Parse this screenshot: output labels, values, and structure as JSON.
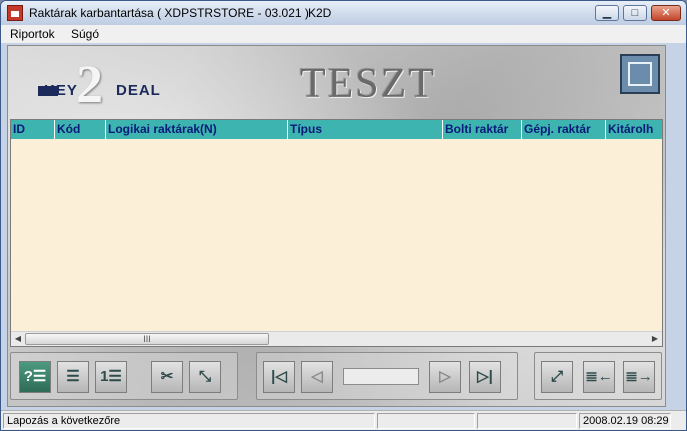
{
  "window": {
    "title": "Raktárak karbantartása ( XDPSTRSTORE - 03.021 )",
    "app_code": "K2D",
    "controls": {
      "minimize": "▁",
      "maximize": "□",
      "close": "✕"
    }
  },
  "menu": [
    {
      "label": "Riportok"
    },
    {
      "label": "Súgó"
    }
  ],
  "banner": {
    "logo": {
      "left": "KEY",
      "digit": "2",
      "right": "DEAL"
    },
    "environment_label": "TESZT"
  },
  "grid": {
    "columns": [
      {
        "label": "ID"
      },
      {
        "label": "Kód"
      },
      {
        "label": "Logikai raktárak(N)"
      },
      {
        "label": "Típus"
      },
      {
        "label": "Bolti raktár"
      },
      {
        "label": "Gépj. raktár"
      },
      {
        "label": "Kitárolh"
      }
    ],
    "rows": [],
    "header_color": "#3db4b0",
    "body_color": "#fcefd8",
    "scroll_thumb_grip": "III"
  },
  "toolbar": {
    "left_group": [
      {
        "icon": "help-list-icon",
        "glyph": "?☰"
      },
      {
        "icon": "list-icon",
        "glyph": "☰"
      },
      {
        "icon": "numbered-list-icon",
        "glyph": "1☰"
      },
      {
        "icon": "tools-icon",
        "glyph": "✂"
      },
      {
        "icon": "unlink-icon",
        "glyph": "⤡"
      }
    ],
    "pager_group": [
      {
        "icon": "first-record-icon",
        "glyph": "|◁"
      },
      {
        "icon": "prev-record-icon",
        "glyph": "◁"
      },
      {
        "icon": "next-record-icon",
        "glyph": "▷"
      },
      {
        "icon": "last-record-icon",
        "glyph": "▷|"
      }
    ],
    "pager_value": "",
    "right_group": [
      {
        "icon": "detach-icon",
        "glyph": "⤢"
      },
      {
        "icon": "move-left-icon",
        "glyph": "≣←"
      },
      {
        "icon": "move-right-icon",
        "glyph": "≣→"
      }
    ]
  },
  "status": {
    "hint": "Lapozás a következőre",
    "segment2": "",
    "segment3": "",
    "datetime": "2008.02.19 08:29"
  }
}
